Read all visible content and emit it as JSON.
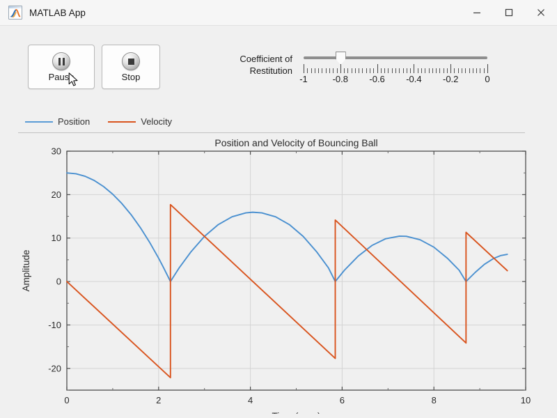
{
  "window": {
    "title": "MATLAB App",
    "app_icon": "matlab-membrane-icon",
    "controls": {
      "minimize": "minimize-icon",
      "maximize": "maximize-icon",
      "close": "close-icon"
    }
  },
  "toolbar": {
    "pause_label": "Pause",
    "pause_icon": "pause-icon",
    "stop_label": "Stop",
    "stop_icon": "stop-icon"
  },
  "slider": {
    "label_line1": "Coefficient of",
    "label_line2": "Restitution",
    "min": -1,
    "max": 0,
    "value": -0.8,
    "tick_labels": [
      "-1",
      "-0.8",
      "-0.6",
      "-0.4",
      "-0.2",
      "0"
    ],
    "tick_values": [
      -1,
      -0.8,
      -0.6,
      -0.4,
      -0.2,
      0
    ],
    "minor_ticks_per_interval": 9
  },
  "legend": {
    "entries": [
      {
        "label": "Position",
        "color": "#5A9BD5"
      },
      {
        "label": "Velocity",
        "color": "#D9541E"
      }
    ]
  },
  "chart_data": {
    "type": "line",
    "title": "Position and Velocity of Bouncing Ball",
    "xlabel": "Time (secs)",
    "ylabel": "Amplitude",
    "xlim": [
      0,
      10
    ],
    "ylim": [
      -25,
      30
    ],
    "xticks": [
      0,
      2,
      4,
      6,
      8,
      10
    ],
    "xtick_labels": [
      "0",
      "2",
      "4",
      "6",
      "8",
      "10"
    ],
    "yticks": [
      -20,
      -10,
      0,
      10,
      20,
      30
    ],
    "ytick_labels": [
      "-20",
      "-10",
      "0",
      "10",
      "20",
      "30"
    ],
    "grid": true,
    "legend_position": "above-plot-left",
    "series": [
      {
        "name": "Position",
        "color": "#4A90D0",
        "points": [
          [
            0.0,
            25.0
          ],
          [
            0.2,
            24.8
          ],
          [
            0.4,
            24.22
          ],
          [
            0.6,
            23.24
          ],
          [
            0.8,
            21.86
          ],
          [
            1.0,
            20.1
          ],
          [
            1.2,
            17.94
          ],
          [
            1.4,
            15.39
          ],
          [
            1.6,
            12.44
          ],
          [
            1.8,
            9.1
          ],
          [
            2.0,
            5.38
          ],
          [
            2.1,
            3.36
          ],
          [
            2.2,
            1.25
          ],
          [
            2.258,
            0.0
          ],
          [
            2.258,
            0.0
          ],
          [
            2.45,
            3.17
          ],
          [
            2.7,
            6.76
          ],
          [
            3.0,
            10.4
          ],
          [
            3.3,
            13.1
          ],
          [
            3.6,
            14.9
          ],
          [
            3.9,
            15.8
          ],
          [
            4.05,
            15.95
          ],
          [
            4.25,
            15.8
          ],
          [
            4.55,
            14.9
          ],
          [
            4.85,
            13.1
          ],
          [
            5.15,
            10.4
          ],
          [
            5.45,
            6.76
          ],
          [
            5.7,
            3.17
          ],
          [
            5.85,
            0.0
          ],
          [
            5.85,
            0.0
          ],
          [
            6.05,
            2.6
          ],
          [
            6.35,
            5.85
          ],
          [
            6.65,
            8.3
          ],
          [
            6.95,
            9.85
          ],
          [
            7.25,
            10.45
          ],
          [
            7.4,
            10.4
          ],
          [
            7.7,
            9.6
          ],
          [
            8.0,
            7.9
          ],
          [
            8.3,
            5.3
          ],
          [
            8.55,
            2.6
          ],
          [
            8.7,
            0.0
          ],
          [
            8.7,
            0.0
          ],
          [
            8.9,
            2.1
          ],
          [
            9.1,
            3.95
          ],
          [
            9.3,
            5.3
          ],
          [
            9.45,
            5.95
          ],
          [
            9.6,
            6.25
          ]
        ]
      },
      {
        "name": "Velocity",
        "color": "#D9541E",
        "points": [
          [
            0.0,
            0.0
          ],
          [
            2.258,
            -22.13
          ],
          [
            2.258,
            17.7
          ],
          [
            5.85,
            -17.7
          ],
          [
            5.85,
            14.15
          ],
          [
            8.7,
            -14.15
          ],
          [
            8.7,
            11.32
          ],
          [
            9.6,
            2.5
          ]
        ]
      }
    ]
  }
}
